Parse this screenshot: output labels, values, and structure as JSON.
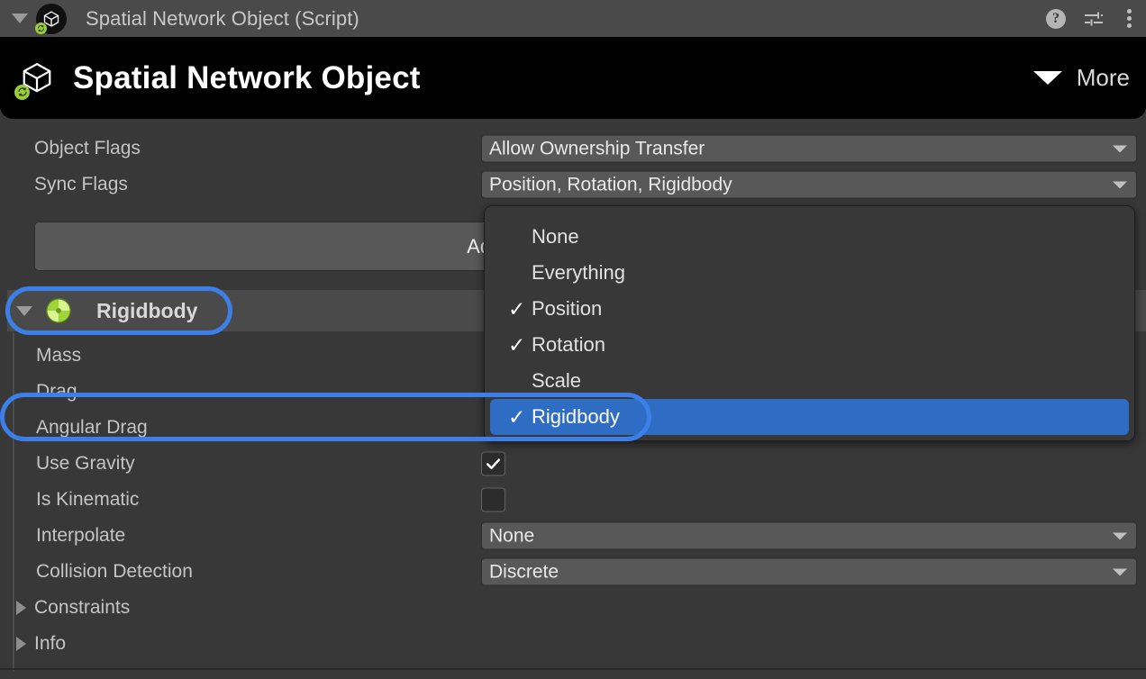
{
  "titlebar": {
    "title": "Spatial Network Object (Script)",
    "icons": [
      "help-icon",
      "presets-icon",
      "overflow-menu-icon"
    ]
  },
  "banner": {
    "title": "Spatial Network Object",
    "more_label": "More"
  },
  "properties": [
    {
      "label": "Object Flags",
      "value": "Allow Ownership Transfer"
    },
    {
      "label": "Sync Flags",
      "value": "Position, Rotation, Rigidbody"
    }
  ],
  "add_button": {
    "label": "Add Visual Components"
  },
  "component": {
    "title": "Rigidbody",
    "icon": "rigidbody-icon",
    "highlighted": true
  },
  "rigidbody": {
    "rows": [
      {
        "label": "Mass",
        "type": "number",
        "value": ""
      },
      {
        "label": "Drag",
        "type": "number",
        "value": ""
      },
      {
        "label": "Angular Drag",
        "type": "number",
        "value": ""
      },
      {
        "label": "Use Gravity",
        "type": "checkbox",
        "checked": true
      },
      {
        "label": "Is Kinematic",
        "type": "checkbox",
        "checked": false
      },
      {
        "label": "Interpolate",
        "type": "dropdown",
        "value": "None"
      },
      {
        "label": "Collision Detection",
        "type": "dropdown",
        "value": "Discrete"
      }
    ],
    "foldouts": [
      {
        "label": "Constraints",
        "expanded": false
      },
      {
        "label": "Info",
        "expanded": false
      }
    ]
  },
  "sync_flags_dropdown": {
    "open": true,
    "items": [
      {
        "label": "None",
        "checked": false,
        "selected": false
      },
      {
        "label": "Everything",
        "checked": false,
        "selected": false
      },
      {
        "label": "Position",
        "checked": true,
        "selected": false
      },
      {
        "label": "Rotation",
        "checked": true,
        "selected": false
      },
      {
        "label": "Scale",
        "checked": false,
        "selected": false
      },
      {
        "label": "Rigidbody",
        "checked": true,
        "selected": true
      }
    ],
    "checkmark_glyph": "✓"
  },
  "colors": {
    "panel_bg": "#383838",
    "header_bg": "#4a4a4a",
    "banner_bg": "#000000",
    "field_bg": "#585858",
    "accent_blue": "#3d7fe8",
    "selection_blue": "#2f6dc4",
    "badge_green": "#9acd3c",
    "text": "#c4c4c4"
  }
}
